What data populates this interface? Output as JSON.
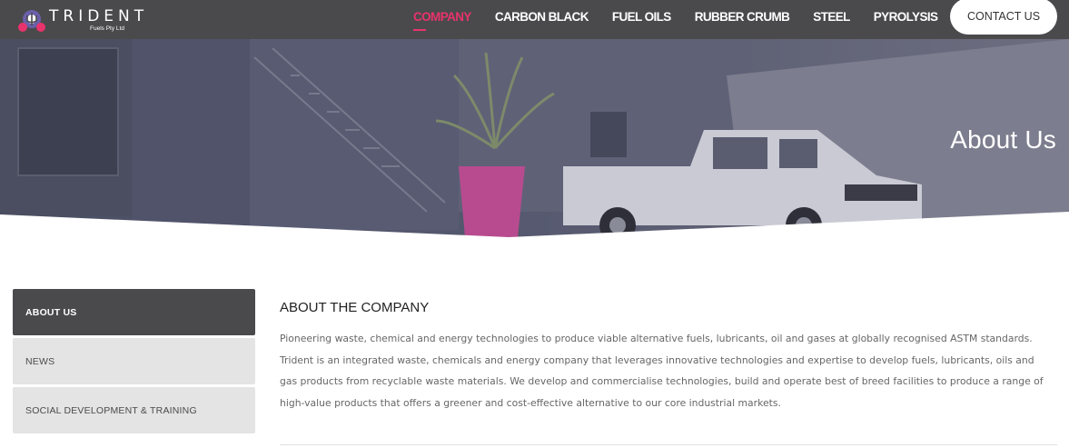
{
  "brand": {
    "name": "TRIDENT",
    "sub": "Fuels Pty Ltd",
    "colors": {
      "header": "#4a4a4c",
      "accent": "#e8336c"
    }
  },
  "nav": {
    "items": [
      {
        "label": "COMPANY",
        "active": true
      },
      {
        "label": "CARBON BLACK"
      },
      {
        "label": "FUEL OILS"
      },
      {
        "label": "RUBBER CRUMB"
      },
      {
        "label": "STEEL"
      },
      {
        "label": "PYROLYSIS"
      }
    ],
    "contact_label": "CONTACT US"
  },
  "hero": {
    "title": "About Us"
  },
  "sidebar": {
    "items": [
      {
        "label": "ABOUT US",
        "active": true
      },
      {
        "label": "NEWS"
      },
      {
        "label": "SOCIAL DEVELOPMENT & TRAINING"
      }
    ]
  },
  "main": {
    "heading": "ABOUT THE COMPANY",
    "lines": [
      "Pioneering waste, chemical and energy technologies to produce viable alternative fuels, lubricants, oil and gases at globally recognised ASTM standards.",
      "Trident is an integrated waste, chemicals and energy company that leverages innovative technologies and expertise to develop fuels, lubricants, oils and",
      "gas products from recyclable waste materials. We develop and commercialise technologies, build and operate best of breed facilities to produce a range of",
      "high-value products that offers a greener and cost-effective alternative to our core industrial markets."
    ]
  }
}
